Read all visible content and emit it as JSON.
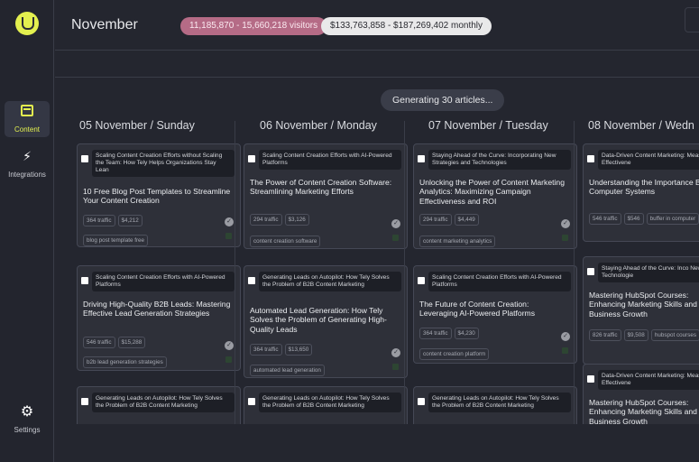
{
  "sidebar": {
    "items": [
      {
        "label": "Content",
        "icon": "calendar-icon"
      },
      {
        "label": "Integrations",
        "icon": "bolt-icon"
      },
      {
        "label": "Settings",
        "icon": "gear-icon"
      }
    ]
  },
  "header": {
    "month": "November",
    "visitors": "11,185,870 - 15,660,218 visitors",
    "monthly": "$133,763,858 - $187,269,402 monthly"
  },
  "board": {
    "generating": "Generating 30 articles...",
    "columns": [
      {
        "title": "05 November / Sunday",
        "cards": [
          {
            "ref": "Scaling Content Creation Efforts without Scaling the Team: How Tely Helps Organizations Stay Lean",
            "title": "10 Free Blog Post Templates to Streamline Your Content Creation",
            "traffic": "364 traffic",
            "value": "$4,212",
            "keyword": "blog post template free"
          },
          {
            "ref": "Scaling Content Creation Efforts with AI-Powered Platforms",
            "title": "Driving High-Quality B2B Leads: Mastering Effective Lead Generation Strategies",
            "traffic": "546 traffic",
            "value": "$15,288",
            "keyword": "b2b lead generation strategies"
          },
          {
            "ref": "Generating Leads on Autopilot: How Tely Solves the Problem of B2B Content Marketing"
          }
        ]
      },
      {
        "title": "06 November / Monday",
        "cards": [
          {
            "ref": "Scaling Content Creation Efforts with AI-Powered Platforms",
            "title": "The Power of Content Creation Software: Streamlining Marketing Efforts",
            "traffic": "294 traffic",
            "value": "$3,126",
            "keyword": "content creation software"
          },
          {
            "ref": "Generating Leads on Autopilot: How Tely Solves the Problem of B2B Content Marketing",
            "title": "Automated Lead Generation: How Tely Solves the Problem of Generating High-Quality Leads",
            "traffic": "364 traffic",
            "value": "$13,650",
            "keyword": "automated lead generation"
          },
          {
            "ref": "Generating Leads on Autopilot: How Tely Solves the Problem of B2B Content Marketing"
          }
        ]
      },
      {
        "title": "07 November / Tuesday",
        "cards": [
          {
            "ref": "Staying Ahead of the Curve: Incorporating New Strategies and Technologies",
            "title": "Unlocking the Power of Content Marketing Analytics: Maximizing Campaign Effectiveness and ROI",
            "traffic": "294 traffic",
            "value": "$4,449",
            "keyword": "content marketing analytics"
          },
          {
            "ref": "Scaling Content Creation Efforts with AI-Powered Platforms",
            "title": "The Future of Content Creation: Leveraging AI-Powered Platforms",
            "traffic": "364 traffic",
            "value": "$4,230",
            "keyword": "content creation platform"
          },
          {
            "ref": "Generating Leads on Autopilot: How Tely Solves the Problem of B2B Content Marketing"
          }
        ]
      },
      {
        "title": "08 November / Wedn",
        "cards": [
          {
            "ref": "Data-Driven Content Marketing: Measuring Campaign Effectivene",
            "title": "Understanding the Importance Buffer in Computer Systems",
            "traffic": "546 traffic",
            "value": "$546",
            "keyword": "buffer in computer"
          },
          {
            "ref": "Staying Ahead of the Curve: Inco New Strategies and Technologie",
            "title": "Mastering HubSpot Courses: Enhancing Marketing Skills and Driving Business Growth",
            "traffic": "826 traffic",
            "value": "$9,508",
            "keyword": "hubspot courses"
          },
          {
            "ref": "Data-Driven Content Marketing: Measuring Campaign Effectivene",
            "title": "Mastering HubSpot Courses: Enhancing Marketing Skills and Driving Business Growth"
          }
        ]
      }
    ]
  }
}
